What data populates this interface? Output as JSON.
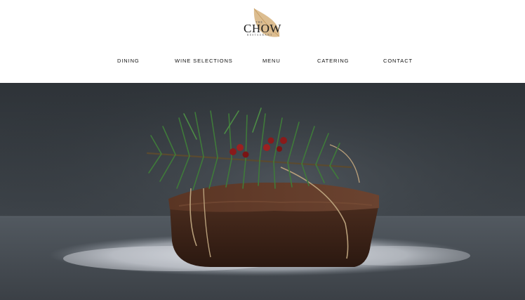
{
  "logo": {
    "small_top": "THE",
    "name": "CHOW",
    "tagline": "RESTAURANT"
  },
  "nav": {
    "items": [
      {
        "label": "DINING"
      },
      {
        "label": "WINE SELECTIONS"
      },
      {
        "label": "MENU"
      },
      {
        "label": "CATERING"
      },
      {
        "label": "CONTACT"
      }
    ]
  },
  "hero": {
    "image_subject": "fruit-cake-with-pine-sprig",
    "colors": {
      "background": "#3a3f44",
      "table": "#5f666d",
      "cake": "#3a2218",
      "pine": "#3f7a3a",
      "berry": "#8a1a1a",
      "sugar": "#e6e9ee"
    }
  },
  "theme": {
    "logo_leaf": "#d6b27c",
    "text": "#111111"
  }
}
